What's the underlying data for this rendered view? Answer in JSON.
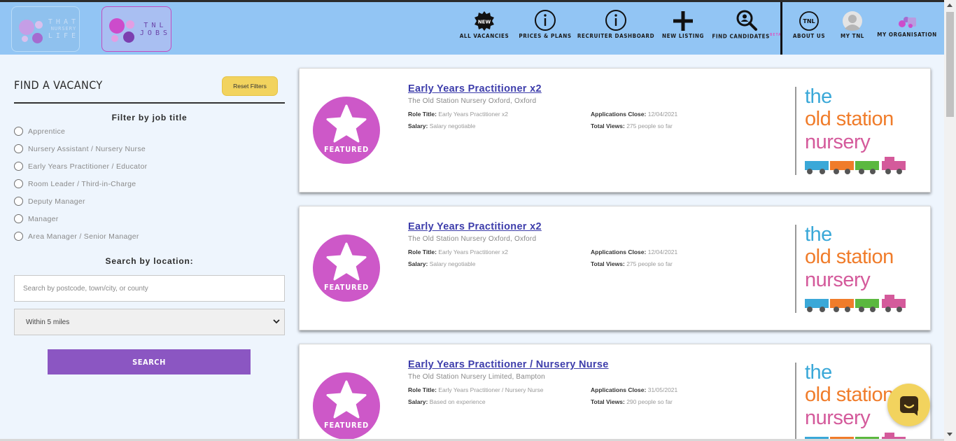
{
  "header": {
    "logos": [
      {
        "line1": "THAT",
        "line2": "NURSERY",
        "line3": "LIFE"
      },
      {
        "line1": "TNL",
        "line2": "JOBS"
      }
    ],
    "nav": [
      {
        "label": "ALL VACANCIES",
        "icon": "new-badge-icon",
        "badge_text": "NEW"
      },
      {
        "label": "PRICES & PLANS",
        "icon": "info-icon"
      },
      {
        "label": "RECRUITER DASHBOARD",
        "icon": "info-icon"
      },
      {
        "label": "NEW LISTING",
        "icon": "plus-icon"
      },
      {
        "label": "FIND CANDIDATES",
        "icon": "search-person-icon",
        "sup": "BETA"
      }
    ],
    "nav_right": [
      {
        "label": "ABOUT US",
        "icon": "tnl-circle-icon",
        "icon_text": "TNL"
      },
      {
        "label": "MY TNL",
        "icon": "avatar-icon"
      },
      {
        "label": "MY ORGANISATION",
        "icon": "organisation-icon"
      }
    ]
  },
  "sidebar": {
    "title": "FIND A VACANCY",
    "reset_label": "Reset Filters",
    "filter_title": "Filter by job title",
    "job_titles": [
      "Apprentice",
      "Nursery Assistant / Nursery Nurse",
      "Early Years Practitioner / Educator",
      "Room Leader / Third-in-Charge",
      "Deputy Manager",
      "Manager",
      "Area Manager / Senior Manager"
    ],
    "location_title": "Search by location:",
    "location_placeholder": "Search by postcode, town/city, or county",
    "distance_value": "Within 5 miles",
    "search_label": "SEARCH"
  },
  "listings": [
    {
      "badge": "FEATURED",
      "title": "Early Years Practitioner x2",
      "employer": "The Old Station Nursery Oxford, Oxford",
      "role_label": "Role Title:",
      "role": "Early Years Practitioner x2",
      "salary_label": "Salary:",
      "salary": "Salary negotiable",
      "close_label": "Applications Close:",
      "close": "12/04/2021",
      "views_label": "Total Views:",
      "views": "275 people so far",
      "logo_words": [
        "the",
        "old station",
        "nursery"
      ]
    },
    {
      "badge": "FEATURED",
      "title": "Early Years Practitioner x2",
      "employer": "The Old Station Nursery Oxford, Oxford",
      "role_label": "Role Title:",
      "role": "Early Years Practitioner x2",
      "salary_label": "Salary:",
      "salary": "Salary negotiable",
      "close_label": "Applications Close:",
      "close": "12/04/2021",
      "views_label": "Total Views:",
      "views": "275 people so far",
      "logo_words": [
        "the",
        "old station",
        "nursery"
      ]
    },
    {
      "badge": "FEATURED",
      "title": "Early Years Practitioner / Nursery Nurse",
      "employer": "The Old Station Nursery Limited, Bampton",
      "role_label": "Role Title:",
      "role": "Early Years Practitioner / Nursery Nurse",
      "salary_label": "Salary:",
      "salary": "Based on experience",
      "close_label": "Applications Close:",
      "close": "31/05/2021",
      "views_label": "Total Views:",
      "views": "290 people so far",
      "logo_words": [
        "the",
        "old station",
        "nursery"
      ]
    }
  ],
  "colors": {
    "header_bg": "#92c5f4",
    "accent_purple": "#8b56c2",
    "featured_pink": "#cd58c8",
    "title_link": "#3d3dab",
    "reset_yellow": "#f2d35e",
    "logo_blue": "#3aa8d8",
    "logo_orange": "#f07c2a",
    "logo_pink": "#d45a9b"
  }
}
